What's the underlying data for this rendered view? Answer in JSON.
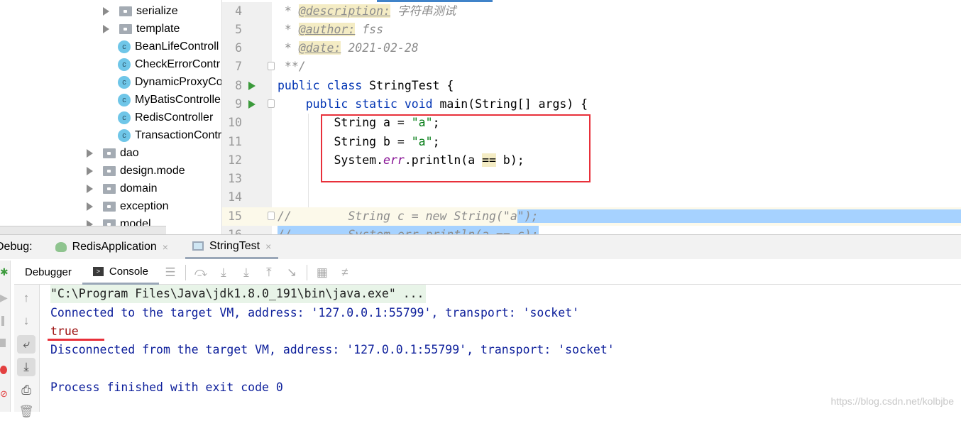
{
  "project_tree": {
    "items": [
      {
        "label": "serialize",
        "type": "folder"
      },
      {
        "label": "template",
        "type": "folder"
      },
      {
        "label": "BeanLifeControll",
        "type": "class"
      },
      {
        "label": "CheckErrorContr",
        "type": "class"
      },
      {
        "label": "DynamicProxyCo",
        "type": "class"
      },
      {
        "label": "MyBatisControlle",
        "type": "class"
      },
      {
        "label": "RedisController",
        "type": "class"
      },
      {
        "label": "TransactionContr",
        "type": "class"
      },
      {
        "label": "dao",
        "type": "folder"
      },
      {
        "label": "design.mode",
        "type": "folder"
      },
      {
        "label": "domain",
        "type": "folder"
      },
      {
        "label": "exception",
        "type": "folder"
      },
      {
        "label": "model",
        "type": "folder"
      }
    ],
    "class_icon_letter": "c"
  },
  "editor": {
    "line_numbers": [
      "4",
      "5",
      "6",
      "7",
      "8",
      "9",
      "10",
      "11",
      "12",
      "13",
      "14",
      "15",
      "16"
    ],
    "lines": {
      "l4_star": " * ",
      "l4_tag": "@description:",
      "l4_text": " 字符串测试",
      "l5_star": " * ",
      "l5_tag": "@author:",
      "l5_text": " fss",
      "l6_star": " * ",
      "l6_tag": "@date:",
      "l6_text": " 2021-02-28",
      "l7": " **/",
      "l8_kw": "public class",
      "l8_rest": " StringTest {",
      "l9_indent": "    ",
      "l9_kw": "public static void",
      "l9_rest": " main(String[] args) {",
      "l10_a": "        String a = ",
      "l10_s": "\"a\"",
      "l10_e": ";",
      "l11_a": "        String b = ",
      "l11_s": "\"a\"",
      "l11_e": ";",
      "l12_a": "        System.",
      "l12_f": "err",
      "l12_b": ".println(a ",
      "l12_eq": "==",
      "l12_c": " b);",
      "l15_a": "//        String c = new String(\"a",
      "l15_b": "\");",
      "l16": "//        System.err.println(a == c);"
    }
  },
  "debug_panel": {
    "label": "Debug:",
    "run_tabs": [
      {
        "label": "RedisApplication",
        "close": "×"
      },
      {
        "label": "StringTest",
        "close": "×"
      }
    ],
    "tabs": [
      {
        "label": "Debugger"
      },
      {
        "label": "Console",
        "icon": ">"
      }
    ],
    "toolbar_icons": [
      "menu-icon",
      "show-execution-point-icon",
      "step-over-icon",
      "step-into-icon",
      "step-out-icon",
      "run-to-cursor-icon",
      "evaluate-icon",
      "trace-icon"
    ],
    "toolbar_glyphs": [
      "☰",
      "⤼",
      "⤓",
      "⤓",
      "⤒",
      "↘",
      "▦",
      "≠"
    ],
    "console_lines": [
      "\"C:\\Program Files\\Java\\jdk1.8.0_191\\bin\\java.exe\" ...",
      "Connected to the target VM, address: '127.0.0.1:55799', transport: 'socket'",
      "true",
      "Disconnected from the target VM, address: '127.0.0.1:55799', transport: 'socket'",
      "Process finished with exit code 0"
    ]
  },
  "watermark": "https://blog.csdn.net/kolbjbe",
  "colors": {
    "accent": "#4083c9",
    "highlight_box": "#e8303a",
    "console_text": "#0d1f9b",
    "selection": "#a6d2ff"
  }
}
